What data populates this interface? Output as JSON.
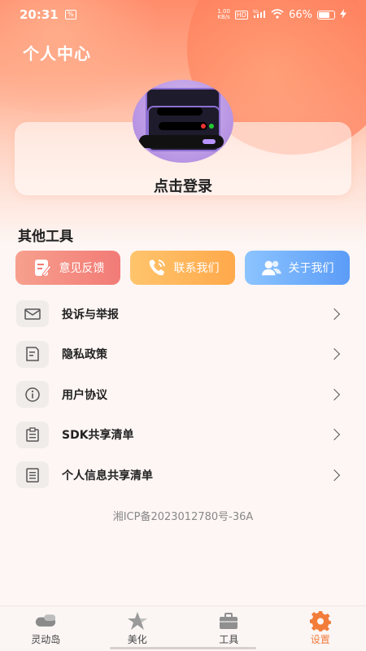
{
  "status_bar": {
    "time": "20:31",
    "notif_label": "%",
    "speed_top": "1.00",
    "speed_bottom": "KB/s",
    "hd": "HD",
    "network": "5G",
    "battery": "66%"
  },
  "header": {
    "title": "个人中心"
  },
  "profile": {
    "login_label": "点击登录"
  },
  "tools": {
    "title": "其他工具",
    "buttons": [
      {
        "label": "意见反馈",
        "icon": "feedback-icon"
      },
      {
        "label": "联系我们",
        "icon": "phone-icon"
      },
      {
        "label": "关于我们",
        "icon": "users-icon"
      }
    ]
  },
  "menu": {
    "items": [
      {
        "label": "投诉与举报",
        "icon": "mail-icon"
      },
      {
        "label": "隐私政策",
        "icon": "document-icon"
      },
      {
        "label": "用户协议",
        "icon": "info-icon"
      },
      {
        "label": "SDK共享清单",
        "icon": "clipboard-icon"
      },
      {
        "label": "个人信息共享清单",
        "icon": "list-doc-icon"
      }
    ]
  },
  "footer": {
    "icp": "湘ICP备2023012780号-36A"
  },
  "tabbar": {
    "tabs": [
      {
        "label": "灵动岛",
        "icon": "island-icon"
      },
      {
        "label": "美化",
        "icon": "star-icon"
      },
      {
        "label": "工具",
        "icon": "toolbox-icon"
      },
      {
        "label": "设置",
        "icon": "gear-icon"
      }
    ],
    "active_index": 3
  },
  "colors": {
    "accent": "#f27c3a",
    "feedback": "#f27b76",
    "contact": "#ffa94b",
    "about": "#5b9cf7"
  }
}
